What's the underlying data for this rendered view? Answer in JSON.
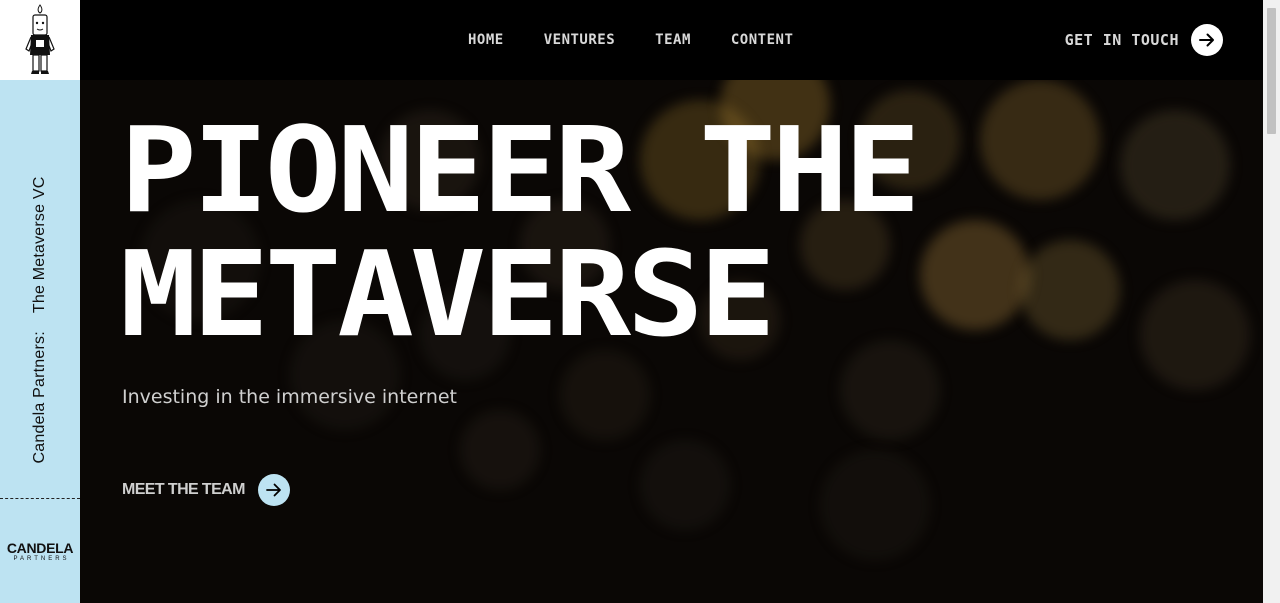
{
  "sidebar": {
    "tagline_left": "Candela Partners:",
    "tagline_right": "The Metaverse VC",
    "brand_main": "CANDELA",
    "brand_sub": "PARTNERS"
  },
  "nav": {
    "items": [
      "HOME",
      "VENTURES",
      "TEAM",
      "CONTENT"
    ],
    "cta_label": "GET IN TOUCH"
  },
  "hero": {
    "title_line1": "PIONEER THE",
    "title_line2": "METAVERSE",
    "subtitle": "Investing in the immersive internet",
    "cta_label": "MEET THE TEAM"
  },
  "colors": {
    "accent": "#bde3f2",
    "background": "#000000",
    "text": "#ffffff"
  },
  "icons": {
    "logo": "candle-mascot-icon",
    "cta": "arrow-right-icon"
  }
}
